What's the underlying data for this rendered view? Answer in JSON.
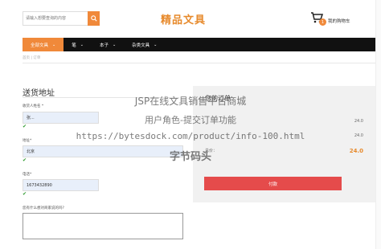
{
  "header": {
    "search_placeholder": "请输入想要查询的内容",
    "logo_text": "精品文具",
    "cart_label": "我的购物车",
    "cart_count": "1"
  },
  "nav": {
    "items": [
      {
        "label": "全部文具",
        "active": true
      },
      {
        "label": "笔",
        "active": false
      },
      {
        "label": "本子",
        "active": false
      },
      {
        "label": "杂类文具",
        "active": false
      }
    ]
  },
  "breadcrumb": "首页  |  订单",
  "form": {
    "title": "送货地址",
    "name_label": "收货人姓名 *",
    "name_value": "张...",
    "address_label": "地址*",
    "address_value": "北京",
    "phone_label": "电话*",
    "phone_value": "1673432890",
    "note_label": "您有什么想对商家说的吗?"
  },
  "summary": {
    "title": "您的订单",
    "rows": [
      {
        "label": "",
        "value": "24.0"
      },
      {
        "label": "",
        "value": "24.0"
      }
    ],
    "total_label": "总价：",
    "total_value": "24.0",
    "pay_label": "付款"
  },
  "watermark": {
    "line1": "JSP在线文具销售平台商城",
    "line2": "用户角色-提交订单功能",
    "line3": "https://bytesdock.com/product/info-100.html",
    "line4": "字节码头"
  },
  "colors": {
    "accent": "#f0893a",
    "nav_bg": "#111111",
    "pay_button": "#e54b4b",
    "check": "#2b9a2b"
  }
}
